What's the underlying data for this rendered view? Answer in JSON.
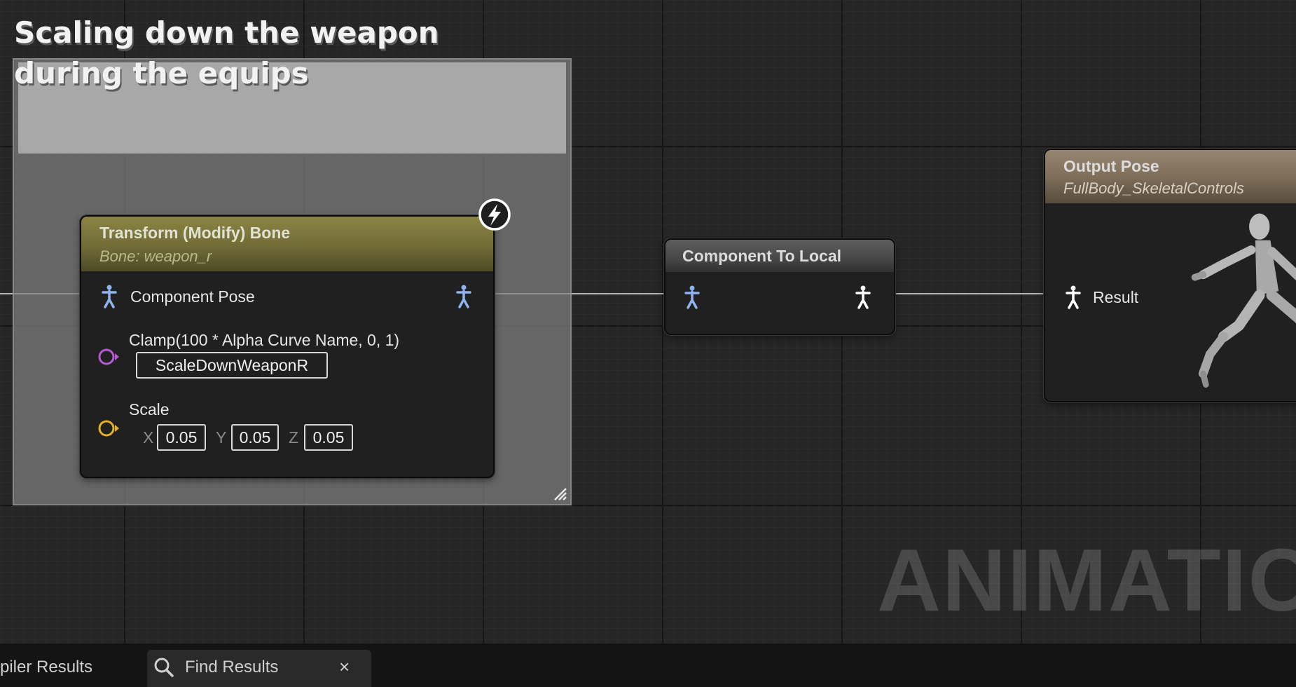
{
  "comment": {
    "title": "Scaling down the weapon during the equips"
  },
  "transform_node": {
    "title": "Transform (Modify) Bone",
    "subtitle": "Bone: weapon_r",
    "pose_label": "Component Pose",
    "alpha_label": "Clamp(100 * Alpha Curve Name, 0, 1)",
    "alpha_curve_value": "ScaleDownWeaponR",
    "scale_label": "Scale",
    "scale": {
      "x_label": "X",
      "x": "0.05",
      "y_label": "Y",
      "y": "0.05",
      "z_label": "Z",
      "z": "0.05"
    }
  },
  "component_to_local_node": {
    "title": "Component To Local"
  },
  "output_node": {
    "title": "Output Pose",
    "subtitle": "FullBody_SkeletalControls",
    "result_label": "Result"
  },
  "watermark": "ANIMATION",
  "tabs": [
    {
      "label": "piler Results"
    },
    {
      "label": "Find Results",
      "close": "×"
    }
  ],
  "icons": [
    "pose-pin-icon",
    "bolt-icon",
    "alpha-pin-icon",
    "scale-pin-icon",
    "mannequin-icon",
    "search-icon",
    "close-icon",
    "resize-grip-icon"
  ],
  "colors": {
    "graph_bg": "#262626",
    "pose_pin_blue": "#8fb3ee",
    "pose_pin_white": "#ffffff",
    "alpha_pin": "#b45bd3",
    "scale_pin": "#e3b028",
    "transform_header": "#7f7a3d",
    "output_header": "#8a7a64"
  }
}
